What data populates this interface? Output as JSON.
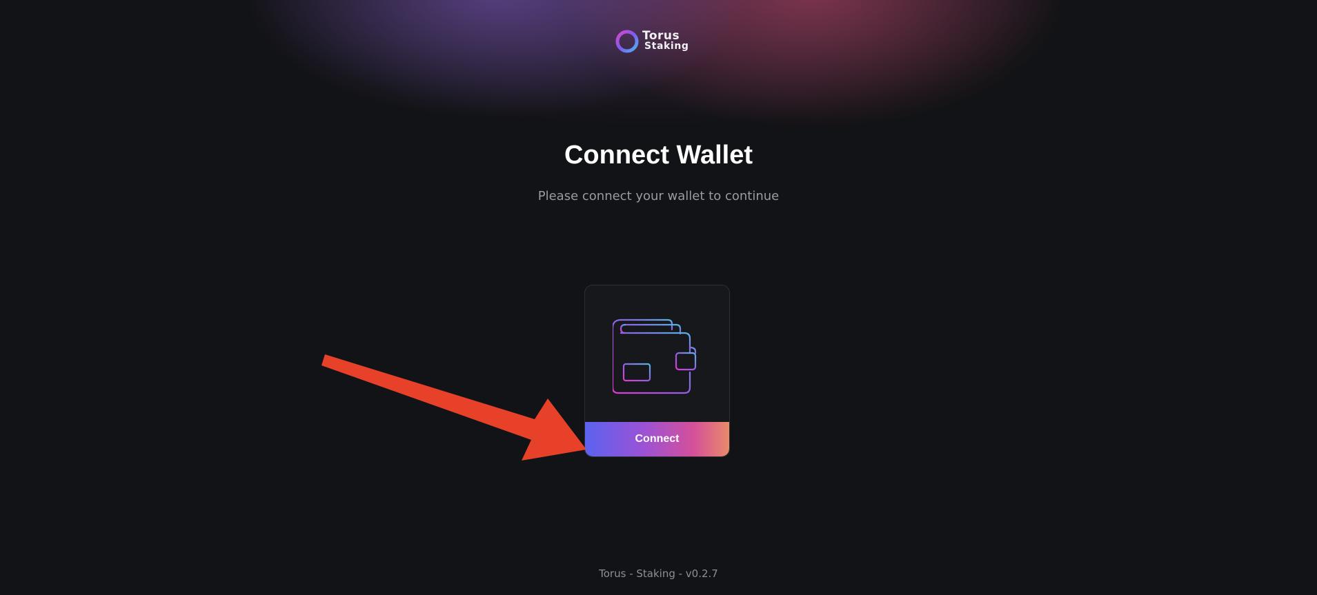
{
  "logo": {
    "line1": "Torus",
    "line2": "Staking",
    "icon": "torus-ring-icon"
  },
  "heading": {
    "title": "Connect Wallet",
    "subtitle": "Please connect your wallet to continue"
  },
  "wallet_card": {
    "icon": "wallet-icon",
    "button_label": "Connect"
  },
  "annotation": {
    "icon": "red-arrow-pointer",
    "color": "#e8412a"
  },
  "footer": {
    "text": "Torus - Staking - v0.2.7"
  },
  "colors": {
    "background": "#121316",
    "button_gradient_start": "#5b63f0",
    "button_gradient_end": "#e98a6a",
    "subtitle_text": "#9a9ba3"
  }
}
